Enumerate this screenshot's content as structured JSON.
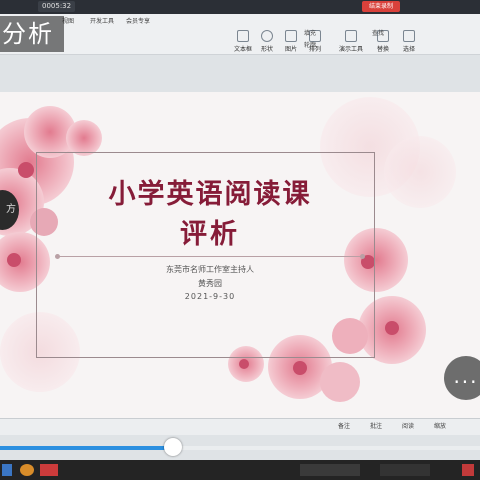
{
  "window": {
    "timer": "0005:32",
    "record_button": "结束录制"
  },
  "ribbon": {
    "tabs": [
      "视图",
      "开发工具",
      "会员专享"
    ],
    "buttons": [
      "文本框",
      "形状",
      "图片",
      "排列",
      "演示工具",
      "替换",
      "选择"
    ],
    "small": [
      "填充",
      "轮廓",
      "查找"
    ]
  },
  "overlay": {
    "title": "分析"
  },
  "slide": {
    "title_line1": "小学英语阅读课",
    "title_line2": "评析",
    "subtitle": "东莞市名师工作室主持人",
    "presenter": "黄秀园",
    "date": "2021-9-30"
  },
  "statusbar": {
    "buttons": [
      "备注",
      "批注",
      "阅读",
      "缩放"
    ]
  },
  "player": {
    "progress": 0.36,
    "more_label": "..."
  },
  "colors": {
    "title": "#861c38",
    "accent": "#2b8fe0",
    "record": "#d9413b"
  }
}
